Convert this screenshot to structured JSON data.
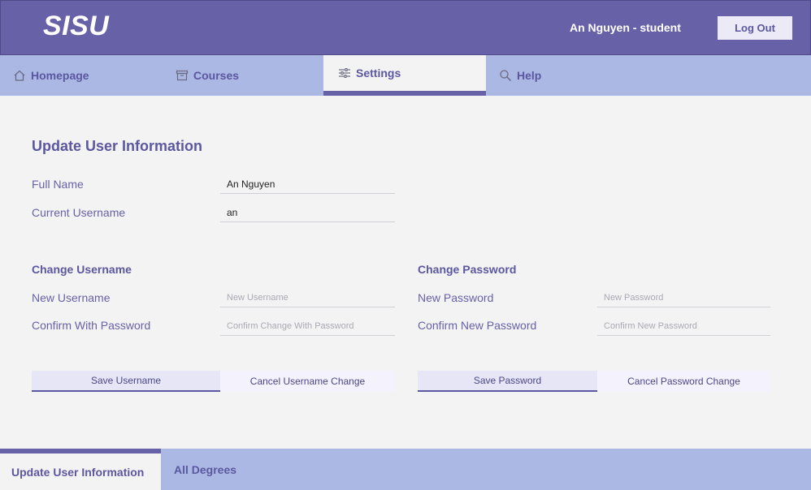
{
  "header": {
    "logo": "SISU",
    "user": "An Nguyen - student",
    "logout_label": "Log Out"
  },
  "nav": {
    "tabs": [
      {
        "label": "Homepage",
        "icon": "home-icon"
      },
      {
        "label": "Courses",
        "icon": "archive-icon"
      },
      {
        "label": "Settings",
        "icon": "sliders-icon",
        "active": true
      },
      {
        "label": "Help",
        "icon": "search-icon"
      }
    ]
  },
  "main": {
    "title": "Update User Information",
    "full_name_label": "Full Name",
    "full_name_value": "An Nguyen",
    "username_label": "Current Username",
    "username_value": "an",
    "change_username": {
      "title": "Change Username",
      "new_label": "New Username",
      "new_placeholder": "New Username",
      "confirm_label": "Confirm With Password",
      "confirm_placeholder": "Confirm Change With Password",
      "save_label": "Save Username",
      "cancel_label": "Cancel Username Change"
    },
    "change_password": {
      "title": "Change Password",
      "new_label": "New Password",
      "new_placeholder": "New Password",
      "confirm_label": "Confirm New Password",
      "confirm_placeholder": "Confirm New Password",
      "save_label": "Save Password",
      "cancel_label": "Cancel Password Change"
    }
  },
  "bottom_tabs": [
    {
      "label": "Update User Information",
      "active": true
    },
    {
      "label": "All Degrees"
    }
  ],
  "colors": {
    "header": "#6762a8",
    "nav": "#aab8e3",
    "accent": "#5b57a0",
    "background": "#f3f3f3"
  }
}
